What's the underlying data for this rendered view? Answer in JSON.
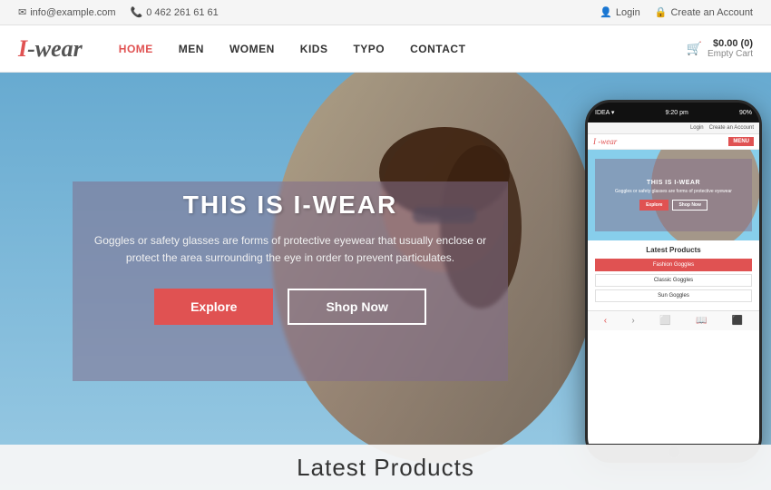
{
  "topbar": {
    "email": "info@example.com",
    "phone": "0 462 261 61 61",
    "login": "Login",
    "create_account": "Create an Account"
  },
  "navbar": {
    "logo_i": "I",
    "logo_rest": "-wear",
    "nav_links": [
      {
        "label": "HOME",
        "active": true
      },
      {
        "label": "MEN",
        "active": false
      },
      {
        "label": "WOMEN",
        "active": false
      },
      {
        "label": "KIDS",
        "active": false
      },
      {
        "label": "TYPO",
        "active": false
      },
      {
        "label": "CONTACT",
        "active": false
      }
    ],
    "cart_price": "$0.00 (0)",
    "cart_status": "Empty Cart"
  },
  "hero": {
    "title": "THIS IS I-WEAR",
    "description": "Goggles or safety glasses are forms of protective eyewear that usually enclose or protect the area surrounding the eye in order to prevent particulates.",
    "btn_explore": "Explore",
    "btn_shop": "Shop Now"
  },
  "phone": {
    "status_bar": "IDEA ▾",
    "time": "9:20 pm",
    "battery": "90%",
    "login": "Login",
    "create_account": "Create an Account",
    "logo": "wear",
    "logo_i": "I",
    "menu_label": "MENU",
    "hero_title": "THIS IS I-WEAR",
    "hero_desc": "Goggles or safety glasses are forms of protective eyewear",
    "btn_explore": "Explore",
    "btn_shop": "Shop Now",
    "products_title": "Latest Products",
    "products": [
      {
        "label": "Fashion Goggles",
        "active": true
      },
      {
        "label": "Classic Goggles",
        "active": false
      },
      {
        "label": "Sun Goggles",
        "active": false
      }
    ]
  },
  "bottom": {
    "title": "Latest Products"
  }
}
